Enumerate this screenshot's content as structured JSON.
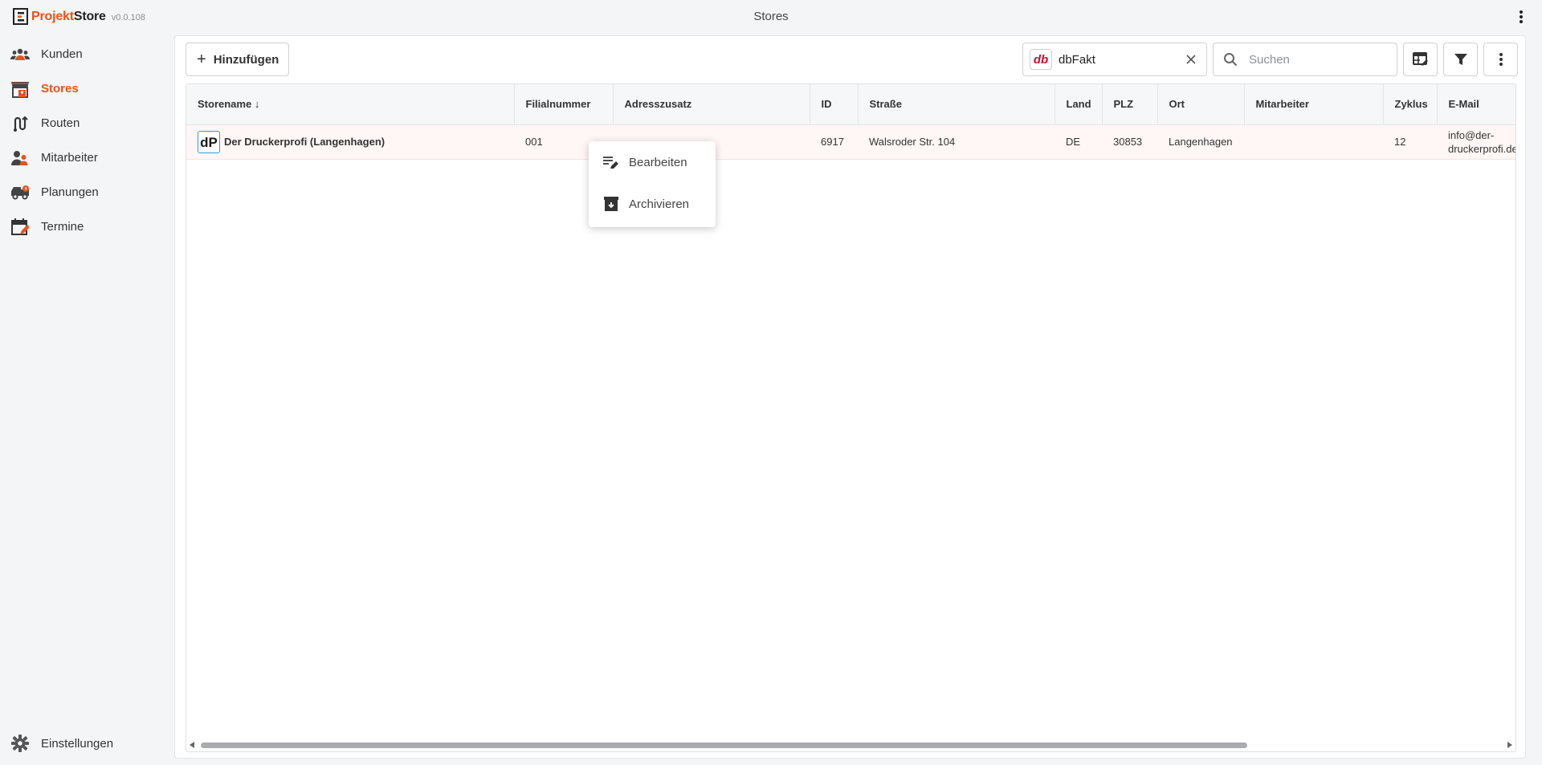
{
  "app": {
    "brand_part1": "Projekt",
    "brand_part2": "Store",
    "version": "v0.0.108",
    "page_title": "Stores",
    "accent_color": "#e8531a"
  },
  "sidebar": {
    "items": [
      {
        "label": "Kunden",
        "icon": "customers-icon"
      },
      {
        "label": "Stores",
        "icon": "store-icon",
        "active": true
      },
      {
        "label": "Routen",
        "icon": "route-icon"
      },
      {
        "label": "Mitarbeiter",
        "icon": "employees-icon"
      },
      {
        "label": "Planungen",
        "icon": "planning-truck-icon"
      },
      {
        "label": "Termine",
        "icon": "calendar-icon"
      }
    ],
    "settings_label": "Einstellungen"
  },
  "toolbar": {
    "add_label": "Hinzufügen",
    "filter_chip_label": "dbFakt",
    "filter_chip_logo": "db",
    "search_placeholder": "Suchen"
  },
  "table": {
    "columns": [
      "Storename",
      "Filialnummer",
      "Adresszusatz",
      "ID",
      "Straße",
      "Land",
      "PLZ",
      "Ort",
      "Mitarbeiter",
      "Zyklus",
      "E-Mail"
    ],
    "sort_indicator": "↓",
    "rows": [
      {
        "storename": "Der Druckerprofi (Langenhagen)",
        "logo_text": "dP",
        "filialnummer": "001",
        "adresszusatz": "",
        "id": "6917",
        "strasse": "Walsroder Str. 104",
        "land": "DE",
        "plz": "30853",
        "ort": "Langenhagen",
        "mitarbeiter": "",
        "zyklus": "12",
        "email_line1": "info@der-",
        "email_line2": "druckerprofi.de"
      }
    ]
  },
  "context_menu": {
    "items": [
      "Bearbeiten",
      "Archivieren"
    ]
  }
}
